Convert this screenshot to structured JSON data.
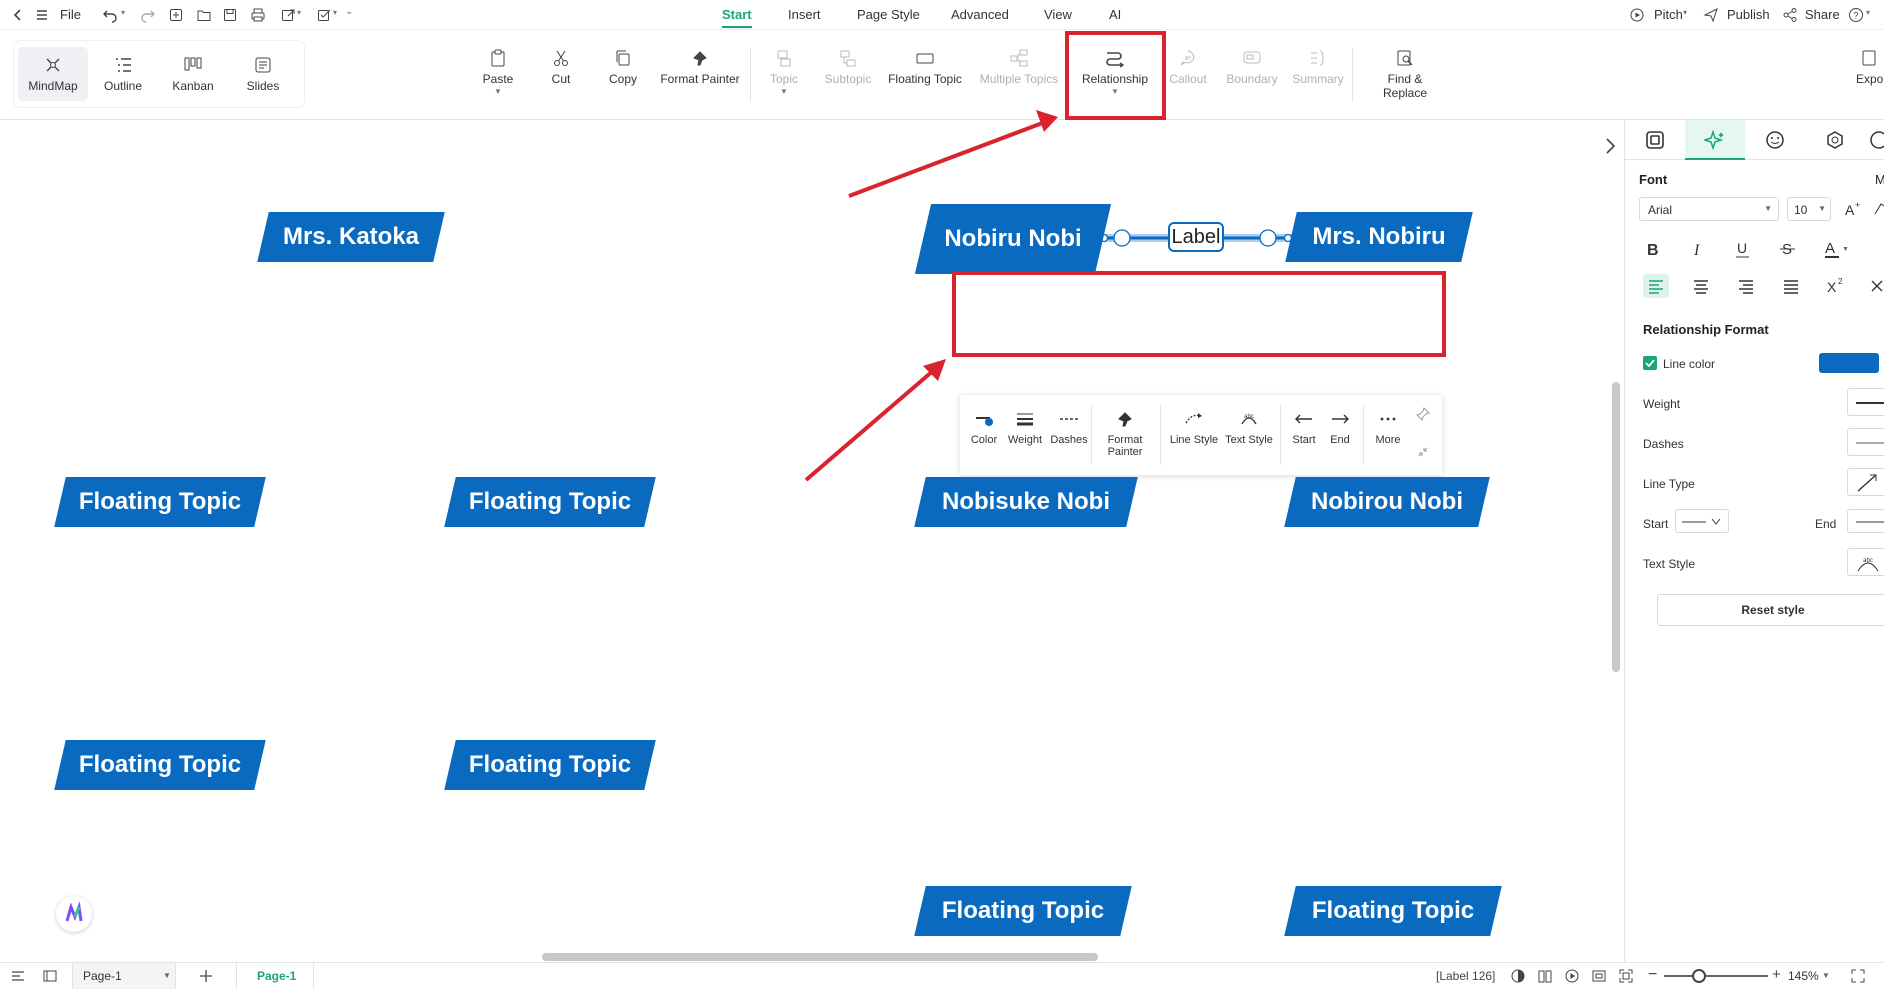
{
  "topbar": {
    "file_label": "File",
    "tabs": [
      "Start",
      "Insert",
      "Page Style",
      "Advanced",
      "View",
      "AI"
    ],
    "pitch": "Pitch",
    "publish": "Publish",
    "share": "Share",
    "help": "?"
  },
  "views": [
    "MindMap",
    "Outline",
    "Kanban",
    "Slides"
  ],
  "ribbon": {
    "paste": "Paste",
    "cut": "Cut",
    "copy": "Copy",
    "format_painter": "Format Painter",
    "topic": "Topic",
    "subtopic": "Subtopic",
    "floating_topic": "Floating Topic",
    "multiple_topics": "Multiple Topics",
    "relationship": "Relationship",
    "callout": "Callout",
    "boundary": "Boundary",
    "summary": "Summary",
    "find_replace": "Find & Replace",
    "export": "Expo"
  },
  "canvas": {
    "topics": {
      "mrs_katoka": "Mrs. Katoka",
      "nobiru_nobi": "Nobiru Nobi",
      "mrs_nobiru": "Mrs. Nobiru",
      "nobisuke_nobi": "Nobisuke Nobi",
      "nobirou_nobi": "Nobirou Nobi",
      "floating": "Floating Topic"
    },
    "relationship_label": "Label",
    "topic_color": "#0a6abf"
  },
  "relbar": {
    "color": "Color",
    "weight": "Weight",
    "dashes": "Dashes",
    "format_painter": "Format\nPainter",
    "format_painter_1": "Format",
    "format_painter_2": "Painter",
    "line_style": "Line Style",
    "text_style": "Text Style",
    "start": "Start",
    "end": "End",
    "more": "More"
  },
  "right_panel": {
    "font_title": "Font",
    "font_family": "Arial",
    "font_size": "10",
    "section_title": "Relationship Format",
    "line_color_label": "Line color",
    "line_color": "#0a6abf",
    "weight_label": "Weight",
    "dashes_label": "Dashes",
    "line_type_label": "Line Type",
    "start_label": "Start",
    "end_label": "End",
    "text_style_label": "Text Style",
    "reset": "Reset style",
    "cut_m": "M"
  },
  "statusbar": {
    "page_select": "Page-1",
    "page_tab": "Page-1",
    "label_count": "[Label 126]",
    "zoom": "145%"
  },
  "colors": {
    "accent": "#1aa57a",
    "highlight": "#d9232d",
    "topic": "#0a6abf"
  }
}
